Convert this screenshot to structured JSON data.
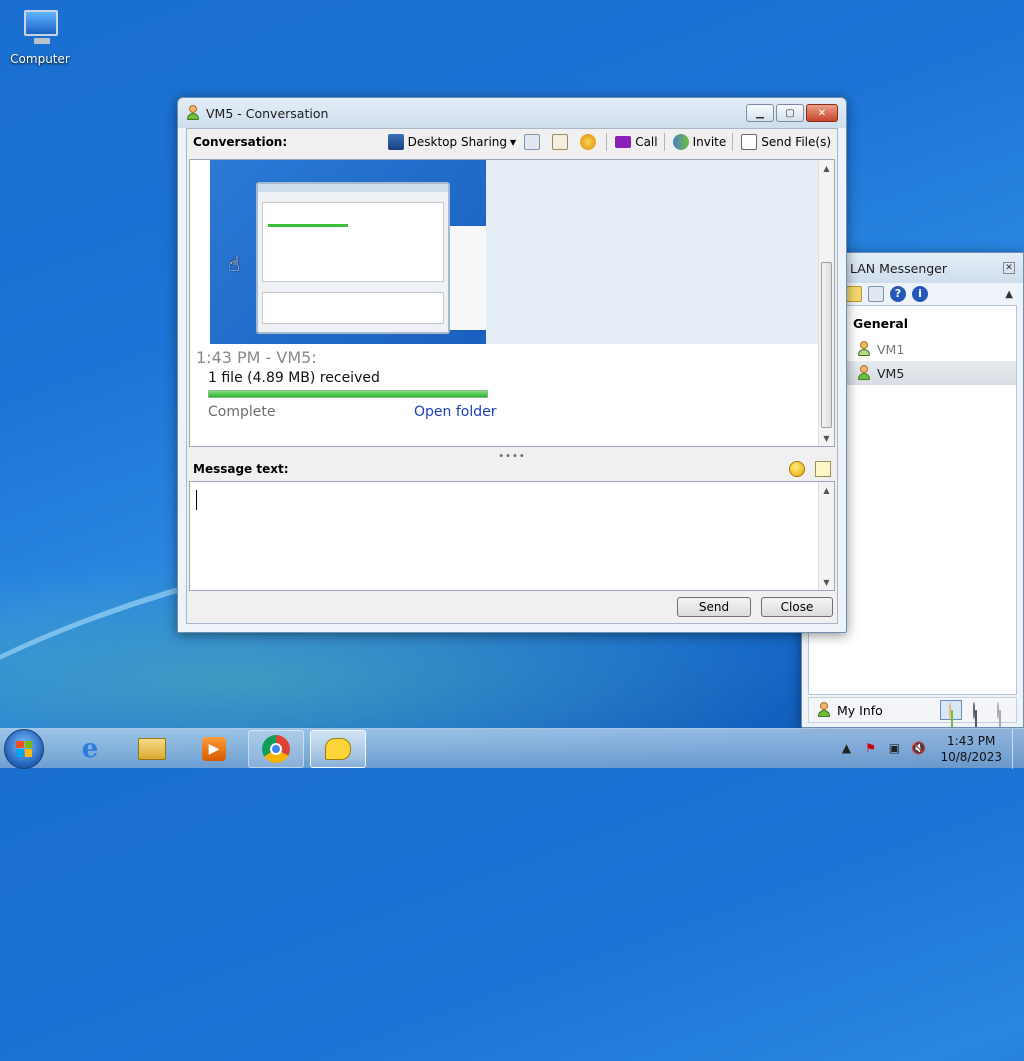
{
  "desktop": {
    "icons": [
      {
        "label": "Computer",
        "icon": "computer-icon"
      }
    ]
  },
  "conversation_window": {
    "title": "VM5 - Conversation",
    "conversation_label": "Conversation:",
    "toolbar": {
      "desktop_sharing": "Desktop Sharing",
      "call": "Call",
      "invite": "Invite",
      "send_files": "Send File(s)"
    },
    "message": {
      "header": "1:43 PM - VM5:",
      "file_text": "1 file (4.89 MB) received",
      "progress": 1.0,
      "status": "Complete",
      "link": "Open folder"
    },
    "message_text_label": "Message text:",
    "input_value": "",
    "buttons": {
      "send": "Send",
      "close": "Close"
    }
  },
  "lan_messenger": {
    "title": "LAN Messenger",
    "group": "General",
    "contacts": [
      {
        "name": "VM1",
        "state": "offline"
      },
      {
        "name": "VM5",
        "state": "online"
      }
    ],
    "my_info": "My Info"
  },
  "taskbar": {
    "apps": [
      "internet-explorer",
      "windows-explorer",
      "media-player",
      "chrome",
      "lan-messenger"
    ],
    "time": "1:43 PM",
    "date": "10/8/2023"
  },
  "colors": {
    "accent_green": "#28b428",
    "link_blue": "#1a3fbf",
    "desktop_blue": "#1d74d6"
  }
}
